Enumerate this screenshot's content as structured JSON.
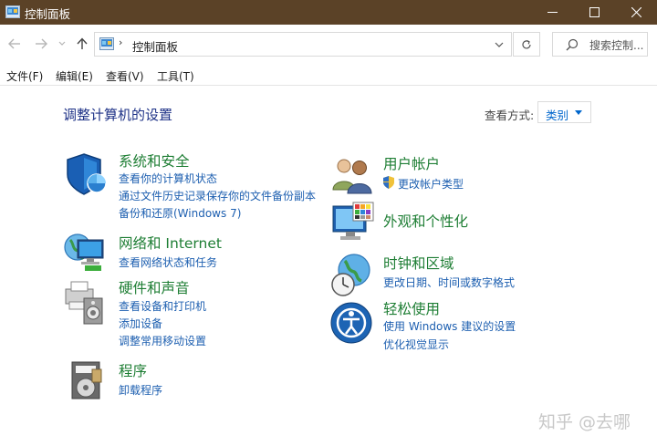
{
  "window": {
    "title": "控制面板",
    "controls": {
      "minimize_icon": "minimize-icon",
      "maximize_icon": "maximize-icon",
      "close_icon": "close-icon"
    }
  },
  "address_bar": {
    "path": "控制面板",
    "search_placeholder": "搜索控制..."
  },
  "menu": [
    "文件(F)",
    "编辑(E)",
    "查看(V)",
    "工具(T)"
  ],
  "content": {
    "heading": "调整计算机的设置",
    "view_by_label": "查看方式:",
    "view_by_value": "类别"
  },
  "categories": [
    {
      "title": "系统和安全",
      "icon": "shield-icon",
      "links": [
        "查看你的计算机状态",
        "通过文件历史记录保存你的文件备份副本",
        "备份和还原(Windows 7)"
      ]
    },
    {
      "title": "网络和 Internet",
      "icon": "network-globe-icon",
      "links": [
        "查看网络状态和任务"
      ]
    },
    {
      "title": "硬件和声音",
      "icon": "printer-speaker-icon",
      "links": [
        "查看设备和打印机",
        "添加设备",
        "调整常用移动设置"
      ]
    },
    {
      "title": "程序",
      "icon": "programs-disc-icon",
      "links": [
        "卸载程序"
      ]
    },
    {
      "title": "用户帐户",
      "icon": "users-icon",
      "links": [
        "更改帐户类型"
      ],
      "link_icon": "uac-shield-icon"
    },
    {
      "title": "外观和个性化",
      "icon": "monitor-palette-icon",
      "links": []
    },
    {
      "title": "时钟和区域",
      "icon": "clock-globe-icon",
      "links": [
        "更改日期、时间或数字格式"
      ]
    },
    {
      "title": "轻松使用",
      "icon": "ease-of-access-icon",
      "links": [
        "使用 Windows 建议的设置",
        "优化视觉显示"
      ]
    }
  ],
  "watermark": "知乎 @去哪",
  "colors": {
    "titlebar": "#5b4227",
    "category_title": "#1e7e34",
    "link": "#1d5fb0",
    "heading": "#1e3287"
  }
}
